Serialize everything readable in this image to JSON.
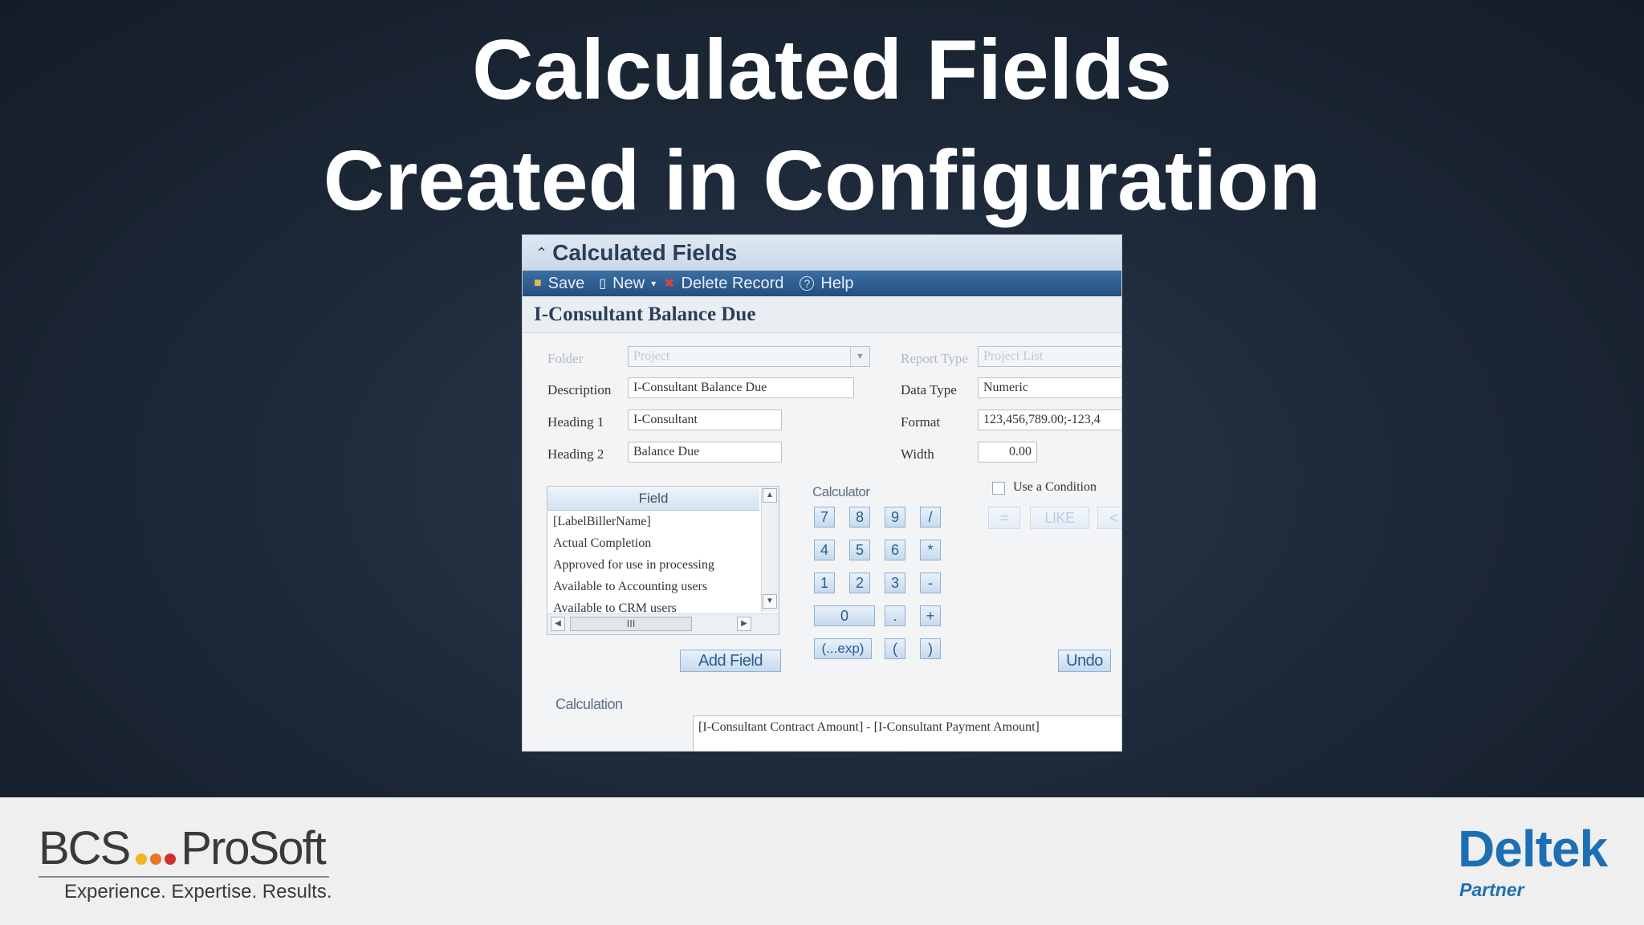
{
  "slide": {
    "title_line1": "Calculated Fields",
    "title_line2": "Created in Configuration"
  },
  "app": {
    "window_title": "Calculated Fields",
    "toolbar": {
      "save": "Save",
      "new": "New",
      "new_arrow": "▾",
      "delete": "Delete Record",
      "help": "Help"
    },
    "record_title": "I-Consultant Balance Due",
    "form": {
      "folder_label": "Folder",
      "folder_value": "Project",
      "report_type_label": "Report Type",
      "report_type_value": "Project List",
      "description_label": "Description",
      "description_value": "I-Consultant Balance Due",
      "data_type_label": "Data Type",
      "data_type_value": "Numeric",
      "heading1_label": "Heading 1",
      "heading1_value": "I-Consultant",
      "format_label": "Format",
      "format_value": "123,456,789.00;-123,4",
      "heading2_label": "Heading 2",
      "heading2_value": "Balance Due",
      "width_label": "Width",
      "width_value": "0.00"
    },
    "field_list": {
      "header": "Field",
      "items": [
        "[LabelBillerName]",
        "Actual Completion",
        "Approved for use in processing",
        "Available to Accounting users",
        "Available to CRM users"
      ],
      "hscroll_thumb": "III"
    },
    "add_field_button": "Add Field",
    "calculator": {
      "label": "Calculator",
      "rows": [
        [
          "7",
          "8",
          "9",
          "/"
        ],
        [
          "4",
          "5",
          "6",
          "*"
        ],
        [
          "1",
          "2",
          "3",
          "-"
        ]
      ],
      "zero": "0",
      "dot": ".",
      "plus": "+",
      "exp": "(...exp)",
      "lparen": "(",
      "rparen": ")"
    },
    "condition": {
      "label": "Use a Condition",
      "equals": "=",
      "like": "LIKE",
      "lt": "<"
    },
    "undo_button": "Undo",
    "calculation_label": "Calculation",
    "calculation_value": "[I-Consultant Contract Amount] - [I-Consultant Payment Amount]"
  },
  "footer": {
    "bcs_left": "BCS",
    "bcs_right": "ProSoft",
    "bcs_tagline": "Experience. Expertise. Results.",
    "deltek_brand": "Deltek",
    "deltek_partner": "Partner"
  },
  "colors": {
    "bcs_dot1": "#f0b323",
    "bcs_dot2": "#e87722",
    "bcs_dot3": "#d0312d",
    "deltek_blue": "#1d6fb5"
  }
}
